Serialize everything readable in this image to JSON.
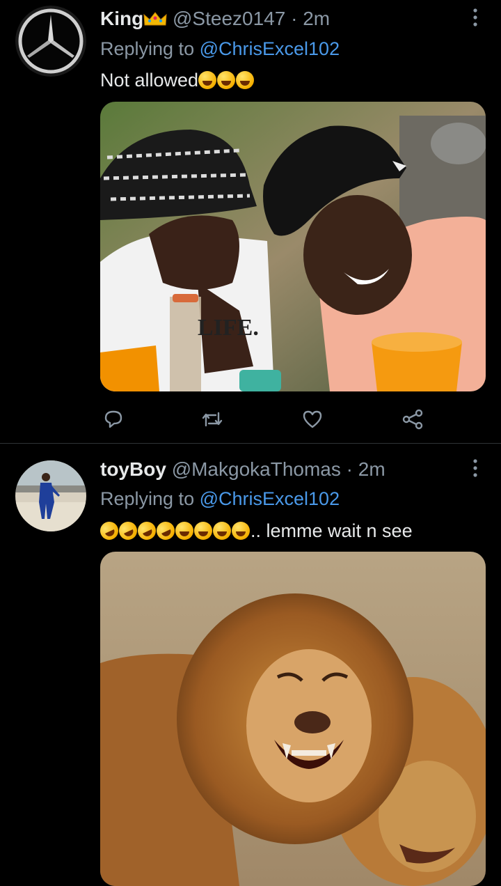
{
  "tweets": [
    {
      "display_name": "King",
      "name_emoji_icon": "crown-icon",
      "handle": "@Steez0147",
      "separator": "·",
      "time": "2m",
      "replying_prefix": "Replying to",
      "replying_to": "@ChrisExcel102",
      "text": "Not allowed",
      "text_emoji_icons": [
        "grinning-squinting-face-icon",
        "grinning-squinting-face-icon",
        "grinning-sweat-face-icon"
      ],
      "avatar_icon": "mercedes-logo-icon",
      "media_icon": "photo-two-men-laughing-icon",
      "media_caption_on_shirt": "LIFE."
    },
    {
      "display_name": "toyBoy",
      "handle": "@MakgokaThomas",
      "separator": "·",
      "time": "2m",
      "replying_prefix": "Replying to",
      "replying_to": "@ChrisExcel102",
      "text_suffix": ".. lemme wait n see",
      "text_emoji_icons": [
        "rolling-laughing-face-icon",
        "rolling-laughing-face-icon",
        "rolling-laughing-face-icon",
        "rolling-laughing-face-icon",
        "grinning-squinting-face-icon",
        "grinning-squinting-face-icon",
        "grinning-squinting-face-icon",
        "grinning-squinting-face-icon"
      ],
      "avatar_icon": "man-in-blue-suit-avatar-icon",
      "media_icon": "photo-laughing-lions-icon"
    }
  ],
  "action_icons": [
    "reply-icon",
    "retweet-icon",
    "like-icon",
    "share-icon"
  ],
  "colors": {
    "background": "#000000",
    "text": "#e7e9ea",
    "secondary": "#8b98a5",
    "link": "#4a99e9",
    "divider": "#2f3336"
  }
}
